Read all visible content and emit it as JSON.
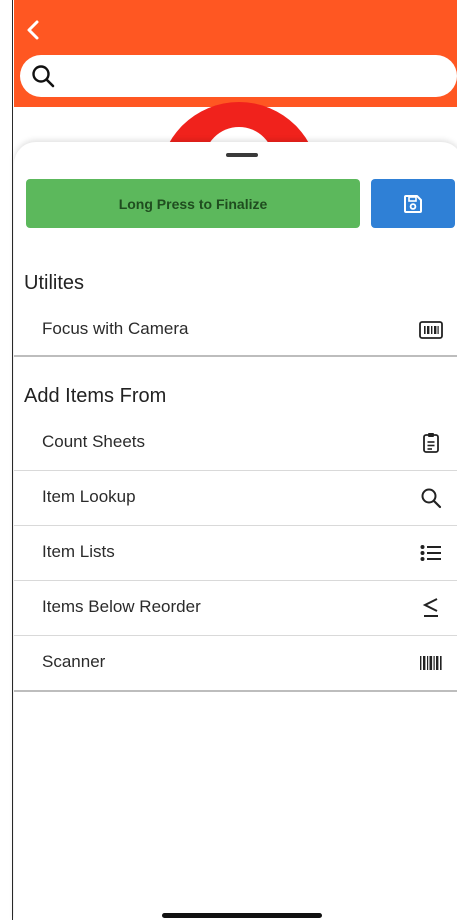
{
  "colors": {
    "header": "#ff5722",
    "finalize": "#5cb85c",
    "save": "#2f80d6",
    "accent_ring": "#f0221c"
  },
  "header": {
    "back_icon": "chevron-left-icon",
    "search_icon": "search-icon"
  },
  "search": {
    "placeholder": ""
  },
  "actions": {
    "finalize_label": "Long Press to Finalize",
    "save_icon": "floppy-disk-icon"
  },
  "utilities": {
    "title": "Utilites",
    "items": [
      {
        "label": "Focus with Camera",
        "icon": "barcode-frame-icon"
      }
    ]
  },
  "add_items": {
    "title": "Add Items From",
    "items": [
      {
        "label": "Count Sheets",
        "icon": "clipboard-icon"
      },
      {
        "label": "Item Lookup",
        "icon": "search-icon"
      },
      {
        "label": "Item Lists",
        "icon": "list-icon"
      },
      {
        "label": "Items Below Reorder",
        "icon": "less-than-or-equal-icon"
      },
      {
        "label": "Scanner",
        "icon": "barcode-icon"
      }
    ]
  }
}
